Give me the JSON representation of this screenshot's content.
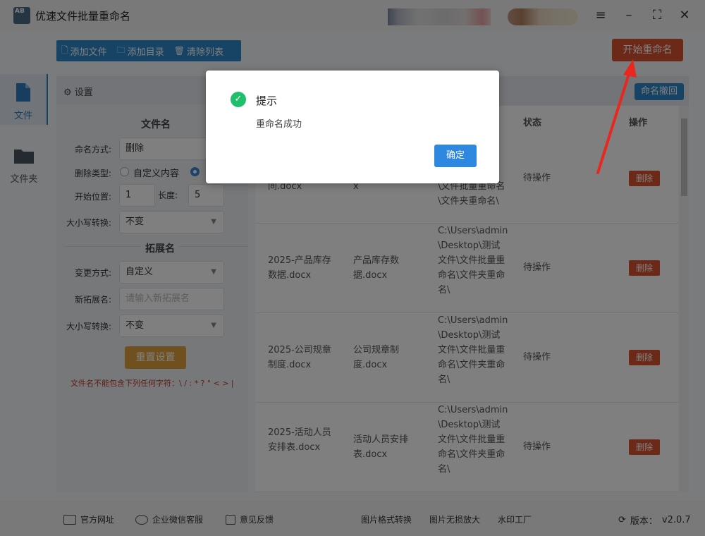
{
  "app": {
    "title": "优速文件批量重命名",
    "logo_text": "AB"
  },
  "window": {
    "menu_icon": "menu-icon",
    "minimize_icon": "minimize-icon",
    "fullscreen_icon": "fullscreen-icon",
    "close_icon": "close-icon"
  },
  "toolbar": {
    "add_file": "添加文件",
    "add_dir": "添加目录",
    "clear_list": "清除列表",
    "start": "开始重命名"
  },
  "sidebar": {
    "items": [
      {
        "label": "文件",
        "icon": "file-icon"
      },
      {
        "label": "文件夹",
        "icon": "folder-icon"
      }
    ]
  },
  "settings": {
    "title": "设置",
    "filename_section": "文件名",
    "naming_mode_label": "命名方式:",
    "naming_mode_value": "删除",
    "delete_type_label": "删除类型:",
    "delete_type_option1": "自定义内容",
    "start_pos_label": "开始位置:",
    "start_pos_value": "1",
    "length_label": "长度:",
    "length_value": "5",
    "case_label": "大小写转换:",
    "case_value": "不变",
    "ext_section": "拓展名",
    "change_mode_label": "变更方式:",
    "change_mode_value": "自定义",
    "new_ext_label": "新拓展名:",
    "new_ext_placeholder": "请输入新拓展名",
    "ext_case_label": "大小写转换:",
    "ext_case_value": "不变",
    "reset": "重置设置",
    "warning": "文件名不能包含下列任何字符：\\ / : * ? \" < > |"
  },
  "table": {
    "undo": "命名撤回",
    "headers": {
      "status": "状态",
      "action": "操作"
    },
    "rows": [
      {
        "orig": "间.docx",
        "new": "x",
        "path": "\\文件批量重命名\\文件夹重命名\\",
        "status": "待操作",
        "action": "删除"
      },
      {
        "orig": "2025-产品库存数据.docx",
        "new": "产品库存数据.docx",
        "path": "C:\\Users\\admin\\Desktop\\测试文件\\文件批量重命名\\文件夹重命名\\",
        "status": "待操作",
        "action": "删除"
      },
      {
        "orig": "2025-公司规章制度.docx",
        "new": "公司规章制度.docx",
        "path": "C:\\Users\\admin\\Desktop\\测试文件\\文件批量重命名\\文件夹重命名\\",
        "status": "待操作",
        "action": "删除"
      },
      {
        "orig": "2025-活动人员安排表.docx",
        "new": "活动人员安排表.docx",
        "path": "C:\\Users\\admin\\Desktop\\测试文件\\文件批量重命名\\文件夹重命名\\",
        "status": "待操作",
        "action": "删除"
      }
    ]
  },
  "footer": {
    "website": "官方网址",
    "wechat": "企业微信客服",
    "feedback": "意见反馈",
    "img_convert": "图片格式转换",
    "img_enlarge": "图片无损放大",
    "watermark": "水印工厂",
    "version_label": "版本：",
    "version": "v2.0.7"
  },
  "dialog": {
    "title": "提示",
    "message": "重命名成功",
    "ok": "确定"
  },
  "colors": {
    "primary": "#2f88c9",
    "danger": "#d9532f",
    "warning": "#e0a13c",
    "success": "#1fbf6e",
    "arrow": "#e8281f"
  }
}
